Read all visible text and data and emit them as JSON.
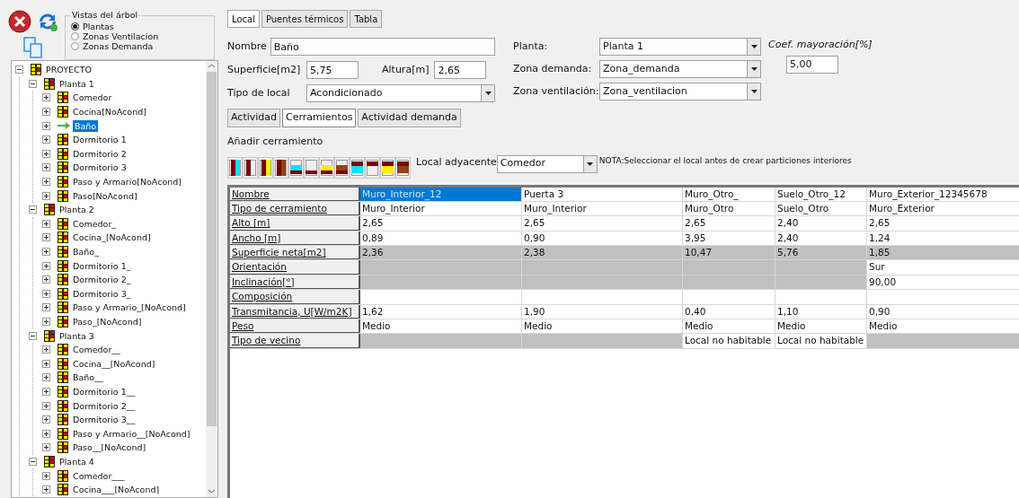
{
  "tree_view": {
    "title": "Vistas del árbol",
    "options": [
      {
        "label": "Plantas",
        "selected": true
      },
      {
        "label": "Zonas Ventilacion",
        "selected": false
      },
      {
        "label": "Zonas Demanda",
        "selected": false
      }
    ]
  },
  "tree": [
    {
      "label": "PROYECTO",
      "kind": "project",
      "expanded": true,
      "selected": false,
      "children": [
        {
          "label": "Planta 1",
          "kind": "floor",
          "expanded": true,
          "selected": false,
          "children": [
            {
              "label": "Comedor",
              "kind": "room",
              "selected": false
            },
            {
              "label": "Cocina[NoAcond]",
              "kind": "room",
              "selected": false
            },
            {
              "label": "Baño",
              "kind": "current",
              "selected": true
            },
            {
              "label": "Dormitorio 1",
              "kind": "room",
              "selected": false
            },
            {
              "label": "Dormitorio 2",
              "kind": "room",
              "selected": false
            },
            {
              "label": "Dormitorio 3",
              "kind": "room",
              "selected": false
            },
            {
              "label": "Paso y Armario[NoAcond]",
              "kind": "room",
              "selected": false
            },
            {
              "label": "Paso[NoAcond]",
              "kind": "room",
              "selected": false
            }
          ]
        },
        {
          "label": "Planta 2",
          "kind": "floor",
          "expanded": true,
          "selected": false,
          "children": [
            {
              "label": "Comedor_",
              "kind": "room",
              "selected": false
            },
            {
              "label": "Cocina_[NoAcond]",
              "kind": "room",
              "selected": false
            },
            {
              "label": "Baño_",
              "kind": "room",
              "selected": false
            },
            {
              "label": "Dormitorio 1_",
              "kind": "room",
              "selected": false
            },
            {
              "label": "Dormitorio 2_",
              "kind": "room",
              "selected": false
            },
            {
              "label": "Dormitorio 3_",
              "kind": "room",
              "selected": false
            },
            {
              "label": "Paso y Armario_[NoAcond]",
              "kind": "room",
              "selected": false
            },
            {
              "label": "Paso_[NoAcond]",
              "kind": "room",
              "selected": false
            }
          ]
        },
        {
          "label": "Planta 3",
          "kind": "floor",
          "expanded": true,
          "selected": false,
          "children": [
            {
              "label": "Comedor__",
              "kind": "room",
              "selected": false
            },
            {
              "label": "Cocina__[NoAcond]",
              "kind": "room",
              "selected": false
            },
            {
              "label": "Baño__",
              "kind": "room",
              "selected": false
            },
            {
              "label": "Dormitorio 1__",
              "kind": "room",
              "selected": false
            },
            {
              "label": "Dormitorio 2__",
              "kind": "room",
              "selected": false
            },
            {
              "label": "Dormitorio 3__",
              "kind": "room",
              "selected": false
            },
            {
              "label": "Paso y Armario__[NoAcond]",
              "kind": "room",
              "selected": false
            },
            {
              "label": "Paso__[NoAcond]",
              "kind": "room",
              "selected": false
            }
          ]
        },
        {
          "label": "Planta 4",
          "kind": "floor",
          "expanded": true,
          "selected": false,
          "children": [
            {
              "label": "Comedor___",
              "kind": "room",
              "selected": false
            },
            {
              "label": "Cocina___[NoAcond]",
              "kind": "room",
              "selected": false
            }
          ]
        }
      ]
    }
  ],
  "tabs": [
    {
      "label": "Local",
      "selected": true
    },
    {
      "label": "Puentes térmicos",
      "selected": false
    },
    {
      "label": "Tabla",
      "selected": false
    }
  ],
  "form": {
    "nombre": {
      "label": "Nombre",
      "value": "Baño"
    },
    "superficie": {
      "label": "Superficie[m2]",
      "value": "5,75"
    },
    "altura": {
      "label": "Altura[m]",
      "value": "2,65"
    },
    "tipo_local": {
      "label": "Tipo de local",
      "value": "Acondicionado"
    },
    "planta": {
      "label": "Planta:",
      "value": "Planta 1"
    },
    "zona_demanda": {
      "label": "Zona demanda:",
      "value": "Zona_demanda"
    },
    "zona_ventilacion": {
      "label": "Zona ventilación:",
      "value": "Zona_ventilacion"
    },
    "coef": {
      "label": "Coef. mayoración[%]",
      "value": "5,00"
    }
  },
  "subtabs": [
    {
      "label": "Actividad",
      "selected": false
    },
    {
      "label": "Cerramientos",
      "selected": true
    },
    {
      "label": "Actividad demanda",
      "selected": false
    }
  ],
  "add_label": "Añadir cerramiento",
  "adjacent": {
    "label": "Local adyacente",
    "value": "Comedor"
  },
  "note": "NOTA:Seleccionar el local antes de crear particiones interiores",
  "grid": [
    {
      "label": "Nombre",
      "cells": [
        {
          "text": "Muro_Interior_12",
          "disabled": false,
          "selected": true
        },
        {
          "text": "Puerta 3",
          "disabled": false,
          "selected": false
        },
        {
          "text": "Muro_Otro_",
          "disabled": false,
          "selected": false
        },
        {
          "text": "Suelo_Otro_12",
          "disabled": false,
          "selected": false
        },
        {
          "text": "Muro_Exterior_12345678",
          "disabled": false,
          "selected": false
        }
      ]
    },
    {
      "label": "Tipo de cerramiento",
      "cells": [
        {
          "text": "Muro_Interior",
          "disabled": false,
          "selected": false
        },
        {
          "text": "Muro_Interior",
          "disabled": false,
          "selected": false
        },
        {
          "text": "Muro_Otro",
          "disabled": false,
          "selected": false
        },
        {
          "text": "Suelo_Otro",
          "disabled": false,
          "selected": false
        },
        {
          "text": "Muro_Exterior",
          "disabled": false,
          "selected": false
        }
      ]
    },
    {
      "label": "Alto [m]",
      "cells": [
        {
          "text": "2,65",
          "disabled": false,
          "selected": false
        },
        {
          "text": "2,65",
          "disabled": false,
          "selected": false
        },
        {
          "text": "2,65",
          "disabled": false,
          "selected": false
        },
        {
          "text": "2,40",
          "disabled": false,
          "selected": false
        },
        {
          "text": "2,65",
          "disabled": false,
          "selected": false
        }
      ]
    },
    {
      "label": "Ancho [m]",
      "cells": [
        {
          "text": "0,89",
          "disabled": false,
          "selected": false
        },
        {
          "text": "0,90",
          "disabled": false,
          "selected": false
        },
        {
          "text": "3,95",
          "disabled": false,
          "selected": false
        },
        {
          "text": "2,40",
          "disabled": false,
          "selected": false
        },
        {
          "text": "1,24",
          "disabled": false,
          "selected": false
        }
      ]
    },
    {
      "label": "Superficie neta[m2]",
      "cells": [
        {
          "text": "2,36",
          "disabled": true,
          "selected": false
        },
        {
          "text": "2,38",
          "disabled": true,
          "selected": false
        },
        {
          "text": "10,47",
          "disabled": true,
          "selected": false
        },
        {
          "text": "5,76",
          "disabled": true,
          "selected": false
        },
        {
          "text": "1,85",
          "disabled": true,
          "selected": false
        }
      ]
    },
    {
      "label": "Orientación",
      "cells": [
        {
          "disabled": true,
          "selected": false
        },
        {
          "disabled": true,
          "selected": false
        },
        {
          "disabled": true,
          "selected": false
        },
        {
          "disabled": true,
          "selected": false
        },
        {
          "text": "Sur",
          "disabled": false,
          "selected": false
        }
      ]
    },
    {
      "label": "Inclinación[°]",
      "cells": [
        {
          "disabled": true,
          "selected": false
        },
        {
          "disabled": true,
          "selected": false
        },
        {
          "disabled": true,
          "selected": false
        },
        {
          "disabled": true,
          "selected": false
        },
        {
          "text": "90,00",
          "disabled": false,
          "selected": false
        }
      ]
    },
    {
      "label": "Composición",
      "cells": [
        {
          "disabled": false,
          "selected": false
        },
        {
          "disabled": false,
          "selected": false
        },
        {
          "disabled": false,
          "selected": false
        },
        {
          "disabled": false,
          "selected": false
        },
        {
          "disabled": false,
          "selected": false
        }
      ]
    },
    {
      "label": "Transmitancia, U[W/m2K]",
      "cells": [
        {
          "text": "1,62",
          "disabled": false,
          "selected": false
        },
        {
          "text": "1,90",
          "disabled": false,
          "selected": false
        },
        {
          "text": "0,40",
          "disabled": false,
          "selected": false
        },
        {
          "text": "1,10",
          "disabled": false,
          "selected": false
        },
        {
          "text": "0,90",
          "disabled": false,
          "selected": false
        }
      ]
    },
    {
      "label": "Peso",
      "cells": [
        {
          "text": "Medio",
          "disabled": false,
          "selected": false
        },
        {
          "text": "Medio",
          "disabled": false,
          "selected": false
        },
        {
          "text": "Medio",
          "disabled": false,
          "selected": false
        },
        {
          "text": "Medio",
          "disabled": false,
          "selected": false
        },
        {
          "text": "Medio",
          "disabled": false,
          "selected": false
        }
      ]
    },
    {
      "label": "Tipo de vecino",
      "cells": [
        {
          "disabled": true,
          "selected": false
        },
        {
          "disabled": true,
          "selected": false
        },
        {
          "text": "Local no habitable",
          "disabled": false,
          "selected": false
        },
        {
          "text": "Local no habitable",
          "disabled": false,
          "selected": false
        },
        {
          "disabled": true,
          "selected": false
        }
      ]
    }
  ]
}
